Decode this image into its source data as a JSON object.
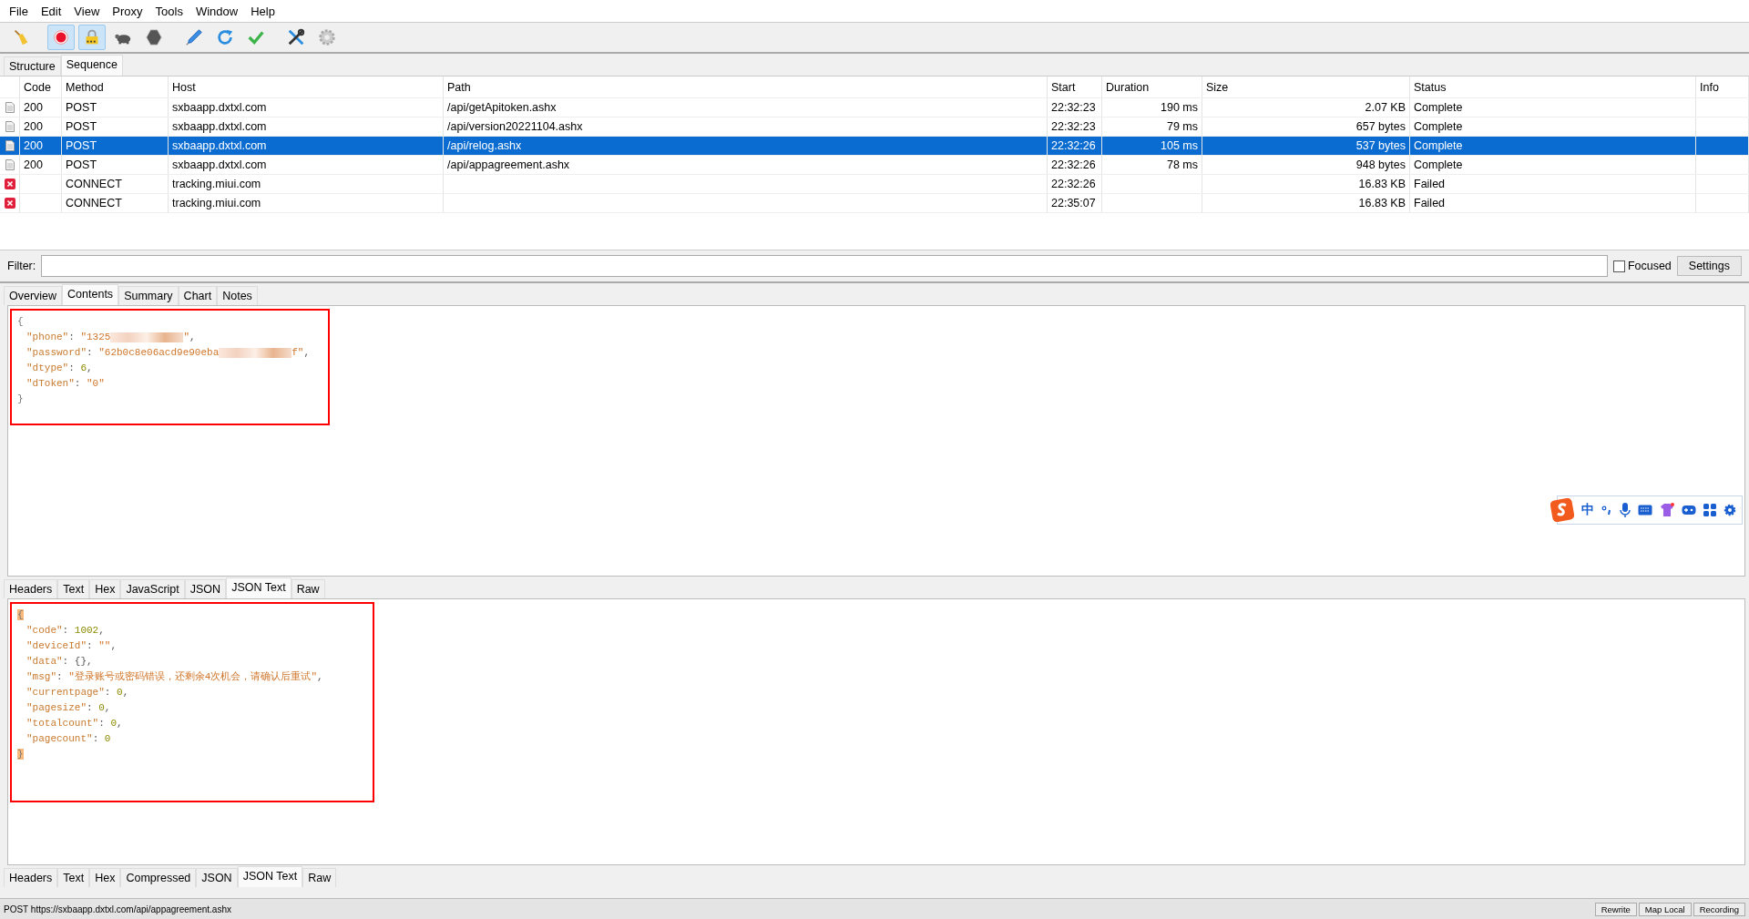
{
  "menu": [
    {
      "label": "File"
    },
    {
      "label": "Edit"
    },
    {
      "label": "View"
    },
    {
      "label": "Proxy"
    },
    {
      "label": "Tools"
    },
    {
      "label": "Window"
    },
    {
      "label": "Help"
    }
  ],
  "toolbar": [
    {
      "kind": "broom",
      "selected": false
    },
    {
      "kind": "record",
      "selected": true
    },
    {
      "kind": "lock",
      "selected": true
    },
    {
      "kind": "turtle",
      "selected": false
    },
    {
      "kind": "stop",
      "selected": false
    },
    {
      "kind": "pen",
      "selected": false
    },
    {
      "kind": "refresh",
      "selected": false
    },
    {
      "kind": "check",
      "selected": false
    },
    {
      "kind": "tools",
      "selected": false
    },
    {
      "kind": "gear",
      "selected": false
    }
  ],
  "view_tabs": [
    {
      "label": "Structure",
      "selected": false
    },
    {
      "label": "Sequence",
      "selected": true
    }
  ],
  "table": {
    "columns": [
      "Code",
      "Method",
      "Host",
      "Path",
      "Start",
      "Duration",
      "Size",
      "Status",
      "Info"
    ],
    "rows": [
      {
        "kind": "ok",
        "selected": false,
        "code": "200",
        "method": "POST",
        "host": "sxbaapp.dxtxl.com",
        "path": "/api/getApitoken.ashx",
        "start": "22:32:23",
        "duration": "190 ms",
        "size": "2.07 KB",
        "status": "Complete"
      },
      {
        "kind": "ok",
        "selected": false,
        "code": "200",
        "method": "POST",
        "host": "sxbaapp.dxtxl.com",
        "path": "/api/version20221104.ashx",
        "start": "22:32:23",
        "duration": "79 ms",
        "size": "657 bytes",
        "status": "Complete"
      },
      {
        "kind": "ok",
        "selected": true,
        "code": "200",
        "method": "POST",
        "host": "sxbaapp.dxtxl.com",
        "path": "/api/relog.ashx",
        "start": "22:32:26",
        "duration": "105 ms",
        "size": "537 bytes",
        "status": "Complete"
      },
      {
        "kind": "ok",
        "selected": false,
        "code": "200",
        "method": "POST",
        "host": "sxbaapp.dxtxl.com",
        "path": "/api/appagreement.ashx",
        "start": "22:32:26",
        "duration": "78 ms",
        "size": "948 bytes",
        "status": "Complete"
      },
      {
        "kind": "failed",
        "selected": false,
        "method": "CONNECT",
        "host": "tracking.miui.com",
        "start": "22:32:26",
        "size": "16.83 KB",
        "status": "Failed"
      },
      {
        "kind": "failed",
        "selected": false,
        "method": "CONNECT",
        "host": "tracking.miui.com",
        "start": "22:35:07",
        "size": "16.83 KB",
        "status": "Failed"
      }
    ]
  },
  "filter": {
    "label": "Filter:"
  },
  "focused": {
    "label": "Focused",
    "checked": false
  },
  "settings_button": "Settings",
  "detail_tabs": [
    {
      "label": "Overview",
      "selected": false
    },
    {
      "label": "Contents",
      "selected": true
    },
    {
      "label": "Summary",
      "selected": false
    },
    {
      "label": "Chart",
      "selected": false
    },
    {
      "label": "Notes",
      "selected": false
    }
  ],
  "request": {
    "outlined": true,
    "lines": [
      {
        "kind": "brace",
        "tokens": [
          {
            "kind": "brace",
            "text": "{",
            "highlighted": false
          }
        ]
      },
      {
        "kind": "member",
        "tokens": [
          {
            "kind": "key",
            "text": "\"phone\""
          },
          {
            "kind": "punct",
            "text": ": "
          },
          {
            "kind": "string",
            "text": "\"1325"
          },
          {
            "kind": "redacted"
          },
          {
            "kind": "string",
            "text": "\""
          },
          {
            "kind": "punct",
            "text": ","
          }
        ]
      },
      {
        "kind": "member",
        "tokens": [
          {
            "kind": "key",
            "text": "\"password\""
          },
          {
            "kind": "punct",
            "text": ": "
          },
          {
            "kind": "string",
            "text": "\"62b0c8e06acd9e90eba"
          },
          {
            "kind": "redacted"
          },
          {
            "kind": "string",
            "text": "f\""
          },
          {
            "kind": "punct",
            "text": ","
          }
        ]
      },
      {
        "kind": "member",
        "tokens": [
          {
            "kind": "key",
            "text": "\"dtype\""
          },
          {
            "kind": "punct",
            "text": ": "
          },
          {
            "kind": "number",
            "text": "6"
          },
          {
            "kind": "punct",
            "text": ","
          }
        ]
      },
      {
        "kind": "member",
        "tokens": [
          {
            "kind": "key",
            "text": "\"dToken\""
          },
          {
            "kind": "punct",
            "text": ": "
          },
          {
            "kind": "string",
            "text": "\"0\""
          }
        ]
      },
      {
        "kind": "brace",
        "tokens": [
          {
            "kind": "brace",
            "text": "}",
            "highlighted": false
          }
        ]
      }
    ]
  },
  "request_tabs": [
    {
      "label": "Headers",
      "selected": false
    },
    {
      "label": "Text",
      "selected": false
    },
    {
      "label": "Hex",
      "selected": false
    },
    {
      "label": "JavaScript",
      "selected": false
    },
    {
      "label": "JSON",
      "selected": false
    },
    {
      "label": "JSON Text",
      "selected": true
    },
    {
      "label": "Raw",
      "selected": false
    }
  ],
  "response": {
    "outlined": true,
    "lines": [
      {
        "kind": "brace",
        "tokens": [
          {
            "kind": "brace",
            "text": "{",
            "highlighted": true
          }
        ]
      },
      {
        "kind": "member",
        "tokens": [
          {
            "kind": "key",
            "text": "\"code\""
          },
          {
            "kind": "punct",
            "text": ": "
          },
          {
            "kind": "number",
            "text": "1002"
          },
          {
            "kind": "punct",
            "text": ","
          }
        ]
      },
      {
        "kind": "member",
        "tokens": [
          {
            "kind": "key",
            "text": "\"deviceId\""
          },
          {
            "kind": "punct",
            "text": ": "
          },
          {
            "kind": "string",
            "text": "\"\""
          },
          {
            "kind": "punct",
            "text": ","
          }
        ]
      },
      {
        "kind": "member",
        "tokens": [
          {
            "kind": "key",
            "text": "\"data\""
          },
          {
            "kind": "punct",
            "text": ": "
          },
          {
            "kind": "punct",
            "text": "{}"
          },
          {
            "kind": "punct",
            "text": ","
          }
        ]
      },
      {
        "kind": "member",
        "tokens": [
          {
            "kind": "key",
            "text": "\"msg\""
          },
          {
            "kind": "punct",
            "text": ": "
          },
          {
            "kind": "string",
            "text": "\"登录账号或密码错误，还剩余4次机会，请确认后重试\""
          },
          {
            "kind": "punct",
            "text": ","
          }
        ]
      },
      {
        "kind": "member",
        "tokens": [
          {
            "kind": "key",
            "text": "\"currentpage\""
          },
          {
            "kind": "punct",
            "text": ": "
          },
          {
            "kind": "number",
            "text": "0"
          },
          {
            "kind": "punct",
            "text": ","
          }
        ]
      },
      {
        "kind": "member",
        "tokens": [
          {
            "kind": "key",
            "text": "\"pagesize\""
          },
          {
            "kind": "punct",
            "text": ": "
          },
          {
            "kind": "number",
            "text": "0"
          },
          {
            "kind": "punct",
            "text": ","
          }
        ]
      },
      {
        "kind": "member",
        "tokens": [
          {
            "kind": "key",
            "text": "\"totalcount\""
          },
          {
            "kind": "punct",
            "text": ": "
          },
          {
            "kind": "number",
            "text": "0"
          },
          {
            "kind": "punct",
            "text": ","
          }
        ]
      },
      {
        "kind": "member",
        "tokens": [
          {
            "kind": "key",
            "text": "\"pagecount\""
          },
          {
            "kind": "punct",
            "text": ": "
          },
          {
            "kind": "number",
            "text": "0"
          }
        ]
      },
      {
        "kind": "brace",
        "tokens": [
          {
            "kind": "brace",
            "text": "}",
            "highlighted": true
          }
        ]
      }
    ]
  },
  "response_tabs": [
    {
      "label": "Headers",
      "selected": false
    },
    {
      "label": "Text",
      "selected": false
    },
    {
      "label": "Hex",
      "selected": false
    },
    {
      "label": "Compressed",
      "selected": false
    },
    {
      "label": "JSON",
      "selected": false
    },
    {
      "label": "JSON Text",
      "selected": true
    },
    {
      "label": "Raw",
      "selected": false
    }
  ],
  "ime": {
    "label": "中"
  },
  "status_bar": {
    "text": "POST https://sxbaapp.dxtxl.com/api/appagreement.ashx",
    "buttons": [
      "Rewrite",
      "Map Local",
      "Recording"
    ]
  }
}
